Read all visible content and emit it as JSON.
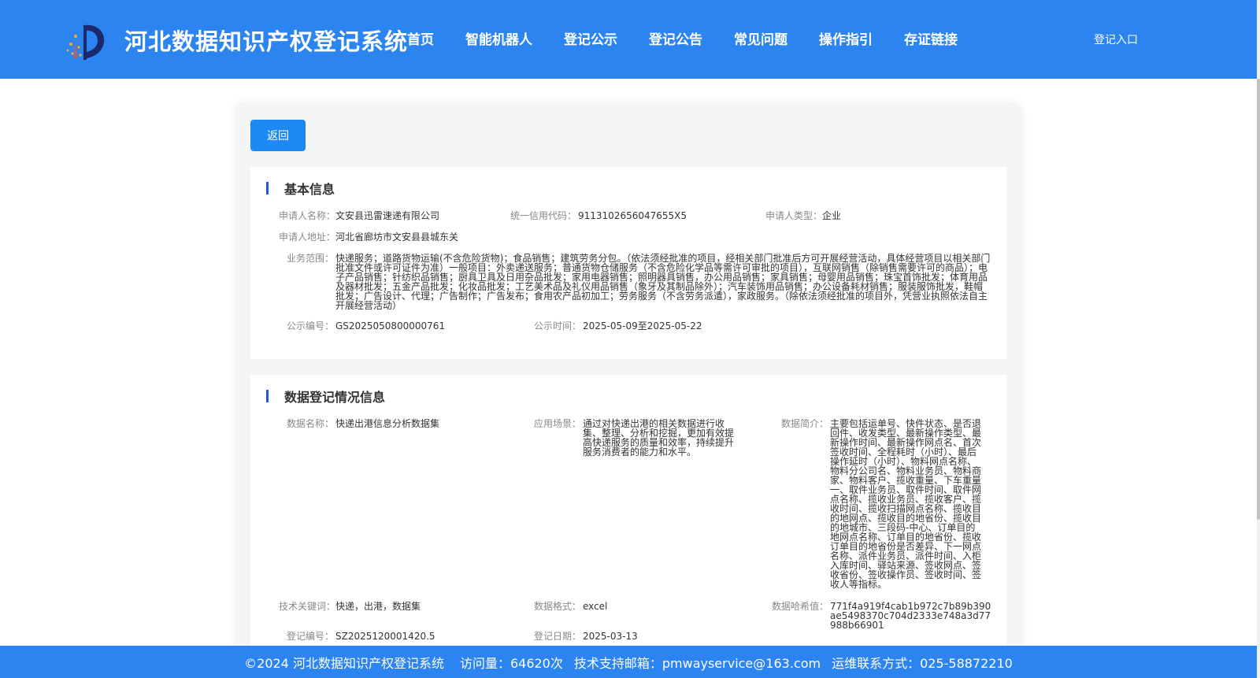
{
  "header": {
    "site_title": "河北数据知识产权登记系统",
    "nav": [
      "首页",
      "智能机器人",
      "登记公示",
      "登记公告",
      "常见问题",
      "操作指引",
      "存证链接"
    ],
    "login": "登记入口"
  },
  "back_label": "返回",
  "basic": {
    "title": "基本信息",
    "applicant_name_label": "申请人名称：",
    "applicant_name": "文安县迅雷速递有限公司",
    "credit_code_label": "统一信用代码：",
    "credit_code": "9113102656047655X5",
    "applicant_type_label": "申请人类型：",
    "applicant_type": "企业",
    "address_label": "申请人地址：",
    "address": "河北省廊坊市文安县县城东关",
    "scope_label": "业务范围：",
    "scope": "快递服务；道路货物运输(不含危险货物)；食品销售；建筑劳务分包。（依法须经批准的项目，经相关部门批准后方可开展经营活动，具体经营项目以相关部门批准文件或许可证件为准）一般项目：外卖递送服务；普通货物仓储服务（不含危险化学品等需许可审批的项目），互联网销售（除销售需要许可的商品）；电子产品销售；针纺织品销售；厨具卫具及日用杂品批发；家用电器销售；照明器具销售，办公用品销售；家具销售；母婴用品销售；珠宝首饰批发；体育用品及器材批发；五金产品批发；化妆品批发；工艺美术品及礼仪用品销售（象牙及其制品除外）；汽车装饰用品销售；办公设备耗材销售；服装服饰批发，鞋帽批发；广告设计、代理；广告制作；广告发布；食用农产品初加工；劳务服务（不含劳务派遣），家政服务。（除依法须经批准的项目外，凭营业执照依法自主开展经营活动）",
    "notice_no_label": "公示编号：",
    "notice_no": "GS2025050800000761",
    "notice_time_label": "公示时间：",
    "notice_time": "2025-05-09至2025-05-22"
  },
  "registration": {
    "title": "数据登记情况信息",
    "data_name_label": "数据名称：",
    "data_name": "快递出港信息分析数据集",
    "scenario_label": "应用场景：",
    "scenario": "通过对快递出港的相关数据进行收集、整理、分析和挖掘，更加有效提高快递服务的质量和效率，持续提升服务消费者的能力和水平。",
    "intro_label": "数据简介：",
    "intro": "主要包括运单号、快件状态、是否退回件、收发类型、最新操作类型、最新操作时间、最新操作网点名、首次签收时间、全程耗时（小时）、最后操作延时（小时）、物料网点名称、物料分公司名、物料业务员、物料商家、物料客户、揽收重量、下车重量一、取件业务员、取件时间、取件网点名称、揽收业务员、揽收客户、揽收时间、揽收扫描网点名称、揽收目的地网点、揽收目的地省份、揽收目的地城市、三段码-中心、订单目的地网点名称、订单目的地省份、揽收订单目的地省份是否差异、下一网点名称、派件业务员、派件时间、入柜入库时间、驿站来源、签收网点、签收省份、签收操作员、签收时间、签收人等指标。",
    "keywords_label": "技术关键词：",
    "keywords": "快递，出港，数据集",
    "format_label": "数据格式：",
    "format": "excel",
    "hash_label": "数据哈希值：",
    "hash": "771f4a919f4cab1b972c7b89b390ae5498370c704d2333e748a3d77988b66901",
    "reg_no_label": "登记编号：",
    "reg_no": "SZ2025120001420.5",
    "reg_date_label": "登记日期：",
    "reg_date": "2025-03-13"
  },
  "footer": {
    "copyright": "©2024 河北数据知识产权登记系统",
    "visits": "访问量：64620次",
    "email": "技术支持邮箱：pmwayservice@163.com",
    "phone": "运维联系方式：025-58872210"
  }
}
